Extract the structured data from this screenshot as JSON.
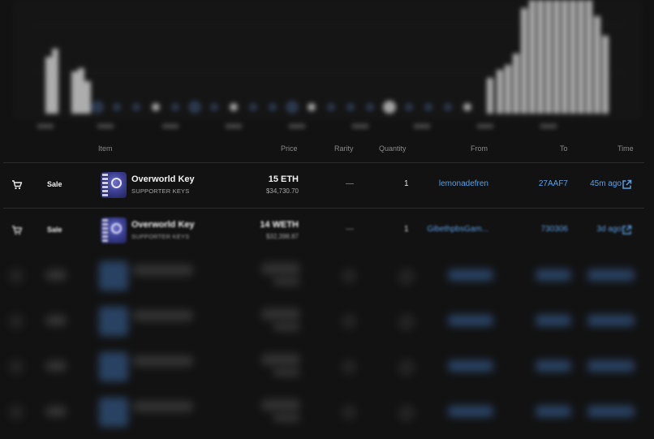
{
  "table": {
    "headers": {
      "item": "Item",
      "price": "Price",
      "rarity": "Rarity",
      "quantity": "Quantity",
      "from": "From",
      "to": "To",
      "time": "Time"
    },
    "rows": [
      {
        "event": "Sale",
        "item_name": "Overworld Key",
        "collection": "SUPPORTER KEYS",
        "price": "15 ETH",
        "price_usd": "$34,730.70",
        "rarity": "—",
        "quantity": "1",
        "from": "lemonadefren",
        "to": "27AAF7",
        "time": "45m ago"
      },
      {
        "event": "Sale",
        "item_name": "Overworld Key",
        "collection": "SUPPORTER KEYS",
        "price": "14 WETH",
        "price_usd": "$32,398.87",
        "rarity": "—",
        "quantity": "1",
        "from": "GibethpbsGam...",
        "to": "730306",
        "time": "3d ago"
      }
    ]
  },
  "icons": {
    "event": "cart-icon",
    "time_link": "external-link-icon"
  },
  "colors": {
    "background": "#121212",
    "link": "#5aa0e6",
    "chart_bar": "#cfcfcf",
    "thumbnail": "#3b3f92"
  }
}
